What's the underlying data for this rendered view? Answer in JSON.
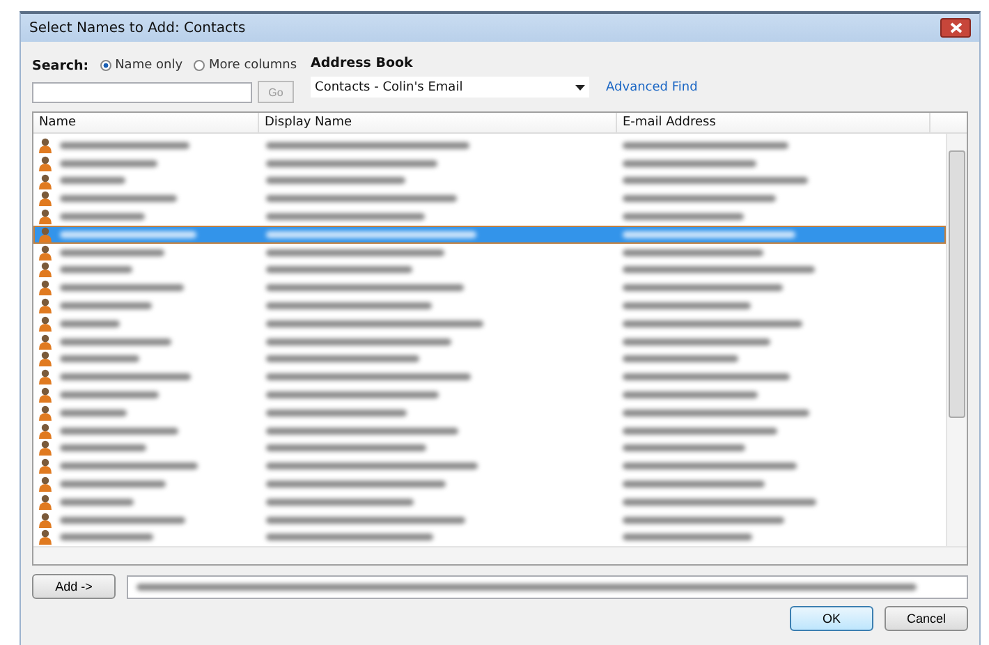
{
  "window": {
    "title": "Select Names to Add: Contacts"
  },
  "search": {
    "label": "Search:",
    "options": [
      {
        "label": "Name only",
        "selected": true
      },
      {
        "label": "More columns",
        "selected": false
      }
    ],
    "go_button": "Go"
  },
  "address_book": {
    "label": "Address Book",
    "value": "Contacts - Colin's Email",
    "advanced_find": "Advanced Find"
  },
  "table": {
    "columns": [
      "Name",
      "Display Name",
      "E-mail Address"
    ],
    "rows": [
      {
        "selected": false
      },
      {
        "selected": false
      },
      {
        "selected": false
      },
      {
        "selected": false
      },
      {
        "selected": false
      },
      {
        "selected": true
      },
      {
        "selected": false
      },
      {
        "selected": false
      },
      {
        "selected": false
      },
      {
        "selected": false
      },
      {
        "selected": false
      },
      {
        "selected": false
      },
      {
        "selected": false
      },
      {
        "selected": false
      },
      {
        "selected": false
      },
      {
        "selected": false
      },
      {
        "selected": false
      },
      {
        "selected": false
      },
      {
        "selected": false
      },
      {
        "selected": false
      },
      {
        "selected": false
      },
      {
        "selected": false
      },
      {
        "selected": false
      }
    ]
  },
  "add_button": "Add ->",
  "buttons": [
    "OK",
    "Cancel"
  ]
}
